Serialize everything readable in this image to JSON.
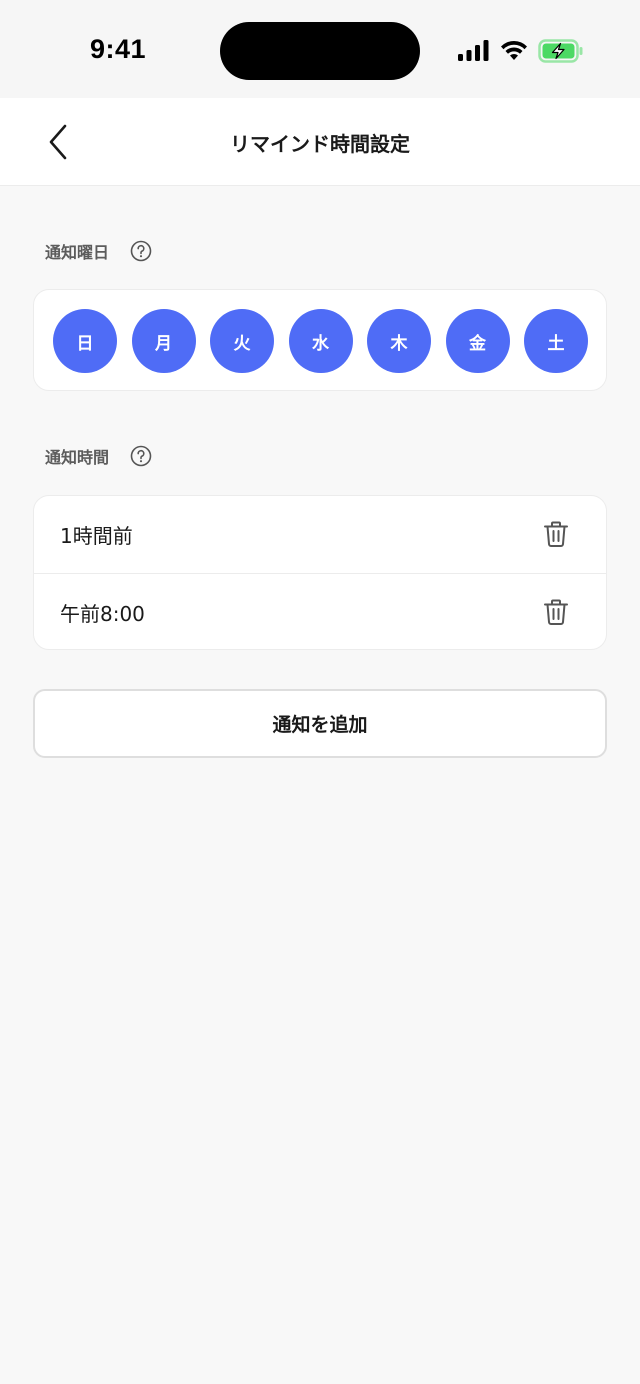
{
  "status_bar": {
    "time": "9:41",
    "icons": [
      "signal-icon",
      "wifi-icon",
      "battery-charging-icon"
    ],
    "battery_color": "#4cd964"
  },
  "nav": {
    "back_icon": "chevron-left-icon",
    "title": "リマインド時間設定"
  },
  "days_section": {
    "label": "通知曜日",
    "help_icon": "question-circle-icon",
    "days": [
      {
        "label": "日",
        "selected": true
      },
      {
        "label": "月",
        "selected": true
      },
      {
        "label": "火",
        "selected": true
      },
      {
        "label": "水",
        "selected": true
      },
      {
        "label": "木",
        "selected": true
      },
      {
        "label": "金",
        "selected": true
      },
      {
        "label": "土",
        "selected": true
      }
    ],
    "selected_color": "#4f6cf6"
  },
  "times_section": {
    "label": "通知時間",
    "help_icon": "question-circle-icon",
    "items": [
      {
        "label": "1時間前",
        "action_icon": "trash-icon"
      },
      {
        "label": "午前8:00",
        "action_icon": "trash-icon"
      }
    ]
  },
  "add_button": {
    "label": "通知を追加"
  }
}
